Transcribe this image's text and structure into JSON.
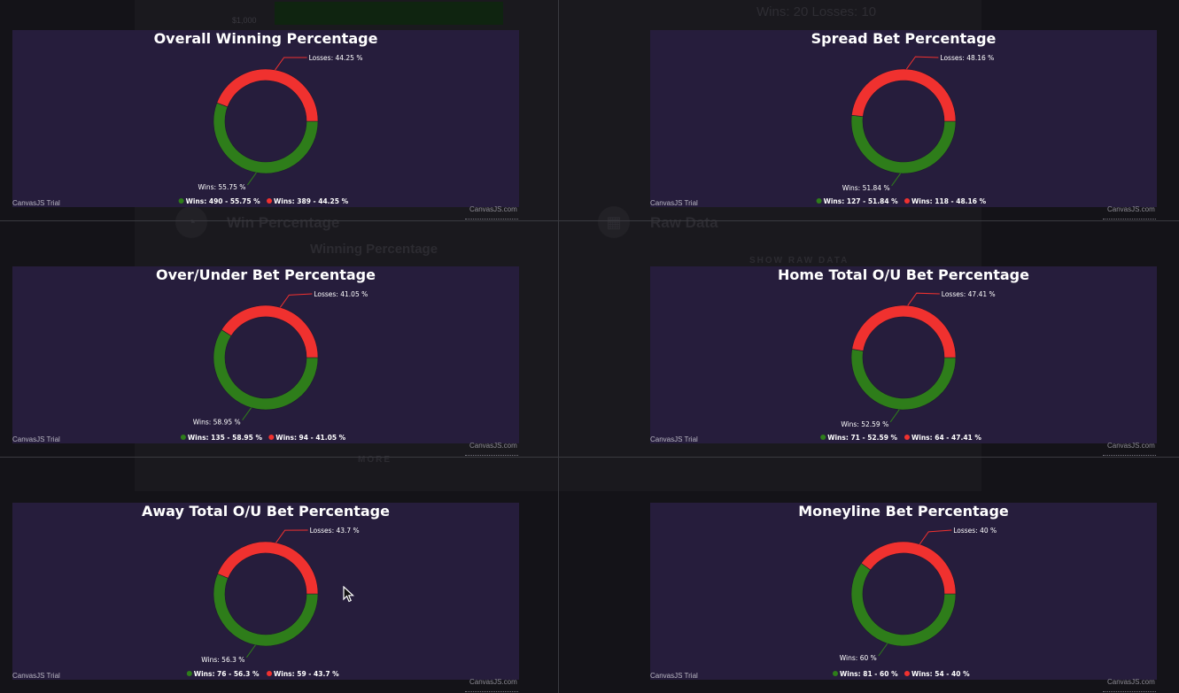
{
  "background": {
    "money_label": "$1,000",
    "wins_losses": "Wins: 20 Losses: 10",
    "win_percentage_title": "Win Percentage",
    "raw_data_title": "Raw Data",
    "winning_percentage_label": "Winning Percentage",
    "show_raw_data_label": "SHOW RAW DATA",
    "more_label": "MORE",
    "win_pct_icon": "pie-chart-icon",
    "raw_data_icon": "table-icon"
  },
  "watermark": "CanvasJS Trial",
  "credit": "CanvasJS.com",
  "colors": {
    "wins": "#2e7d1a",
    "losses": "#f0312f",
    "panel": "#261d3c",
    "connector_wins": "#2e7d1a",
    "connector_losses": "#f0312f"
  },
  "chart_data": [
    {
      "type": "pie",
      "title": "Overall Winning Percentage",
      "slices": [
        {
          "name": "Wins",
          "value": 55.75,
          "count": 490,
          "index_label": "Wins: 55.75 %",
          "legend": "Wins: 490 - 55.75 %"
        },
        {
          "name": "Losses",
          "value": 44.25,
          "count": 389,
          "index_label": "Losses: 44.25 %",
          "legend": "Wins: 389 - 44.25 %"
        }
      ]
    },
    {
      "type": "pie",
      "title": "Spread Bet Percentage",
      "slices": [
        {
          "name": "Wins",
          "value": 51.84,
          "count": 127,
          "index_label": "Wins: 51.84 %",
          "legend": "Wins: 127 - 51.84 %"
        },
        {
          "name": "Losses",
          "value": 48.16,
          "count": 118,
          "index_label": "Losses: 48.16 %",
          "legend": "Wins: 118 - 48.16 %"
        }
      ]
    },
    {
      "type": "pie",
      "title": "Over/Under Bet Percentage",
      "slices": [
        {
          "name": "Wins",
          "value": 58.95,
          "count": 135,
          "index_label": "Wins: 58.95 %",
          "legend": "Wins: 135 - 58.95 %"
        },
        {
          "name": "Losses",
          "value": 41.05,
          "count": 94,
          "index_label": "Losses: 41.05 %",
          "legend": "Wins: 94 - 41.05 %"
        }
      ]
    },
    {
      "type": "pie",
      "title": "Home Total O/U Bet Percentage",
      "slices": [
        {
          "name": "Wins",
          "value": 52.59,
          "count": 71,
          "index_label": "Wins: 52.59 %",
          "legend": "Wins: 71 - 52.59 %"
        },
        {
          "name": "Losses",
          "value": 47.41,
          "count": 64,
          "index_label": "Losses: 47.41 %",
          "legend": "Wins: 64 - 47.41 %"
        }
      ]
    },
    {
      "type": "pie",
      "title": "Away Total O/U Bet Percentage",
      "slices": [
        {
          "name": "Wins",
          "value": 56.3,
          "count": 76,
          "index_label": "Wins: 56.3 %",
          "legend": "Wins: 76 - 56.3 %"
        },
        {
          "name": "Losses",
          "value": 43.7,
          "count": 59,
          "index_label": "Losses: 43.7 %",
          "legend": "Wins: 59 - 43.7 %"
        }
      ]
    },
    {
      "type": "pie",
      "title": "Moneyline Bet Percentage",
      "slices": [
        {
          "name": "Wins",
          "value": 60,
          "count": 81,
          "index_label": "Wins: 60 %",
          "legend": "Wins: 81 - 60 %"
        },
        {
          "name": "Losses",
          "value": 40,
          "count": 54,
          "index_label": "Losses: 40 %",
          "legend": "Wins: 54 - 40 %"
        }
      ]
    }
  ]
}
